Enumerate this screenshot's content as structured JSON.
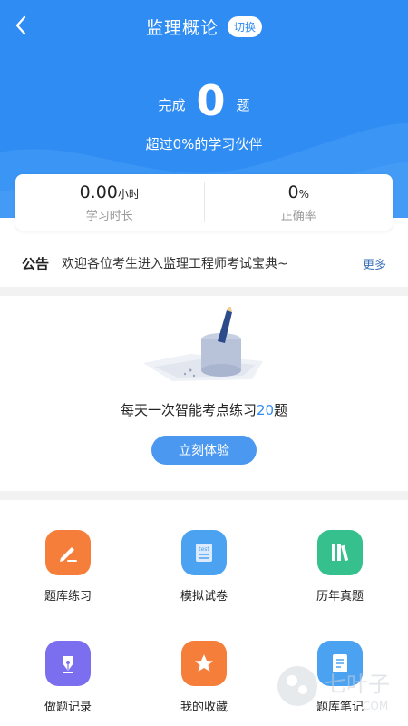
{
  "header": {
    "title": "监理概论",
    "switch_label": "切换"
  },
  "progress": {
    "prefix": "完成",
    "count": "0",
    "suffix": "题",
    "beat_text": "超过0%的学习伙伴"
  },
  "stats": [
    {
      "value": "0.00",
      "unit": "小时",
      "label": "学习时长"
    },
    {
      "value": "0",
      "unit": "%",
      "label": "正确率"
    }
  ],
  "notice": {
    "tag": "公告",
    "text": "欢迎各位考生进入监理工程师考试宝典~",
    "more": "更多"
  },
  "daily": {
    "text_pre": "每天一次智能考点练习",
    "count": "20",
    "text_post": "题",
    "button": "立刻体验"
  },
  "features": [
    {
      "label": "题库练习",
      "icon": "pen-icon",
      "color": "#f57e3a"
    },
    {
      "label": "模拟试卷",
      "icon": "test-paper-icon",
      "color": "#4ba2f0"
    },
    {
      "label": "历年真题",
      "icon": "books-icon",
      "color": "#35c08e"
    },
    {
      "label": "做题记录",
      "icon": "fountain-pen-icon",
      "color": "#7b6ff0"
    },
    {
      "label": "我的收藏",
      "icon": "star-icon",
      "color": "#f57e3a"
    },
    {
      "label": "题库笔记",
      "icon": "notes-icon",
      "color": "#4ba2f0"
    }
  ],
  "icon_label_test": "test",
  "watermark": {
    "text": "七叶子",
    "sub": "COM"
  },
  "colors": {
    "primary": "#2f8cf3",
    "button": "#4b98f0",
    "separator": "#f2f2f2"
  }
}
